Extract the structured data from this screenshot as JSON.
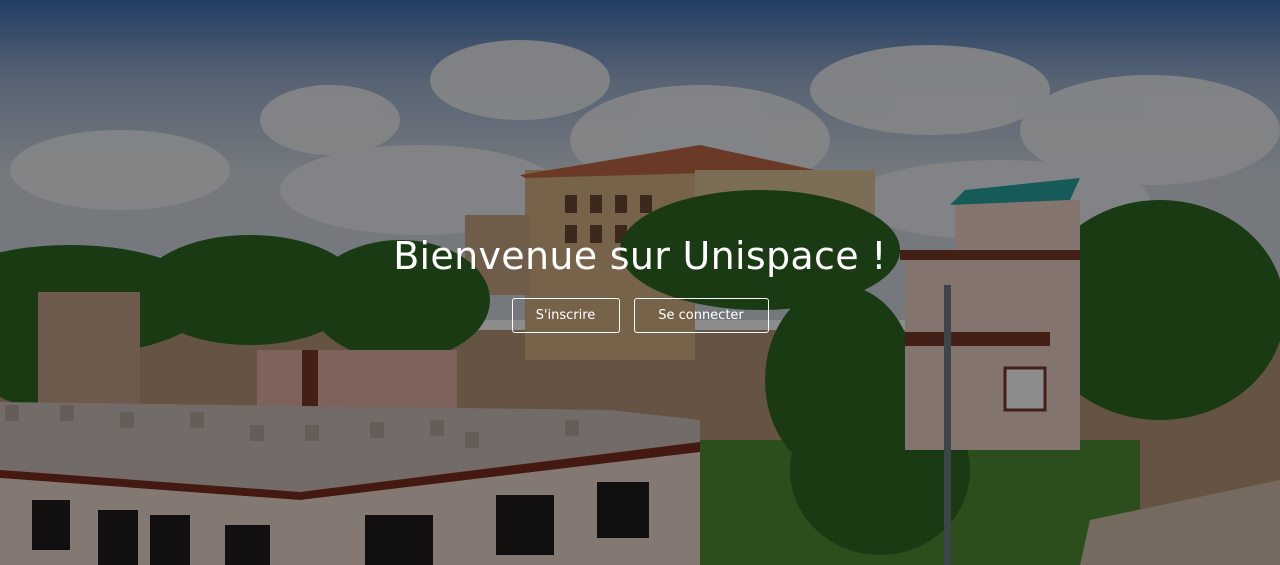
{
  "hero": {
    "title": "Bienvenue sur Unispace !",
    "background_image": "campus-photo"
  },
  "actions": {
    "register_label": "S'inscrire",
    "login_label": "Se connecter"
  },
  "colors": {
    "text": "#ffffff",
    "overlay": "rgba(0,0,0,0.45)"
  }
}
